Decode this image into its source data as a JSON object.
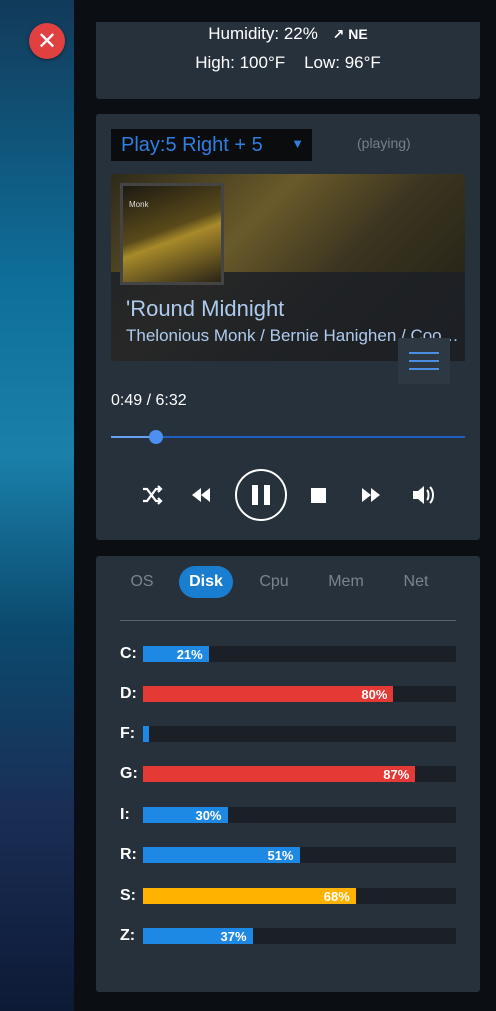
{
  "weather": {
    "humidity_text": "Humidity: 22%",
    "wind_arrow": "↗",
    "wind_dir": "NE",
    "high_text": "High: 100°F",
    "low_text": "Low: 96°F"
  },
  "player": {
    "playlist_value": "Play:5 Right + 5",
    "select_arrow_icon": "▼",
    "status": "(playing)",
    "album_thumb_text": "Monk",
    "track_title": "'Round Midnight",
    "track_artist": "Thelonious Monk / Bernie Hanighen / Cootie Williams",
    "current_time": "0:49",
    "time_separator": "/",
    "total_time": "6:32",
    "progress_fraction": 0.126,
    "icons": {
      "menu": "hamburger-icon",
      "shuffle": "shuffle-icon",
      "rewind": "rewind-icon",
      "pause": "pause-icon",
      "stop": "stop-icon",
      "forward": "fast-forward-icon",
      "volume": "volume-icon"
    }
  },
  "system": {
    "tabs": [
      {
        "label": "OS",
        "active": false
      },
      {
        "label": "Disk",
        "active": true
      },
      {
        "label": "Cpu",
        "active": false
      },
      {
        "label": "Mem",
        "active": false
      },
      {
        "label": "Net",
        "active": false
      }
    ],
    "disks": [
      {
        "drive": "C:",
        "percent": 21,
        "label": "21%",
        "color": "#1e88e5"
      },
      {
        "drive": "D:",
        "percent": 80,
        "label": "80%",
        "color": "#e53935"
      },
      {
        "drive": "F:",
        "percent": 0,
        "label": "",
        "color": "#1e88e5"
      },
      {
        "drive": "G:",
        "percent": 87,
        "label": "87%",
        "color": "#e53935"
      },
      {
        "drive": "I:",
        "percent": 27,
        "label": "30%",
        "color": "#1e88e5"
      },
      {
        "drive": "R:",
        "percent": 50,
        "label": "51%",
        "color": "#1e88e5"
      },
      {
        "drive": "S:",
        "percent": 68,
        "label": "68%",
        "color": "#ffb300"
      },
      {
        "drive": "Z:",
        "percent": 35,
        "label": "37%",
        "color": "#1e88e5"
      }
    ]
  },
  "desktop": {
    "close_icon": "✕"
  }
}
